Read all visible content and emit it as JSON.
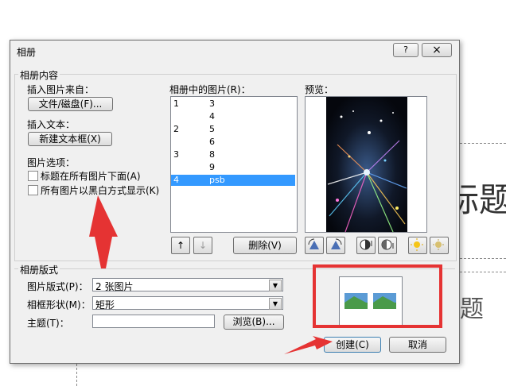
{
  "slide": {
    "bg_text_1": "标题",
    "bg_text_2": "题"
  },
  "dialog": {
    "title": "相册",
    "help_label": "?",
    "close_label": "×",
    "content_group": "相册内容",
    "insert_from_label": "插入图片来自：",
    "file_disk_button": "文件/磁盘(F)...",
    "insert_text_label": "插入文本：",
    "new_textbox_button": "新建文本框(X)",
    "picture_options_label": "图片选项：",
    "option_captions": "标题在所有图片下面(A)",
    "option_bw": "所有图片以黑白方式显示(K)",
    "pictures_label": "相册中的图片(R)：",
    "pictures": [
      {
        "page": "1",
        "name": "3",
        "selected": false
      },
      {
        "page": "",
        "name": "4",
        "selected": false
      },
      {
        "page": "2",
        "name": "5",
        "selected": false
      },
      {
        "page": "",
        "name": "6",
        "selected": false
      },
      {
        "page": "3",
        "name": "8",
        "selected": false
      },
      {
        "page": "",
        "name": "9",
        "selected": false
      },
      {
        "page": "4",
        "name": "psb",
        "selected": true
      }
    ],
    "move_up_label": "↑",
    "move_down_label": "↓",
    "delete_button": "删除(V)",
    "preview_label": "预览：",
    "layout_group": "相册版式",
    "picture_layout_label": "图片版式(P)：",
    "picture_layout_value": "2 张图片",
    "frame_shape_label": "相框形状(M)：",
    "frame_shape_value": "矩形",
    "theme_label": "主题(T)：",
    "theme_value": "",
    "browse_button": "浏览(B)...",
    "create_button": "创建(C)",
    "cancel_button": "取消"
  },
  "colors": {
    "annotation_red": "#e53333",
    "selection_blue": "#3399ff"
  }
}
